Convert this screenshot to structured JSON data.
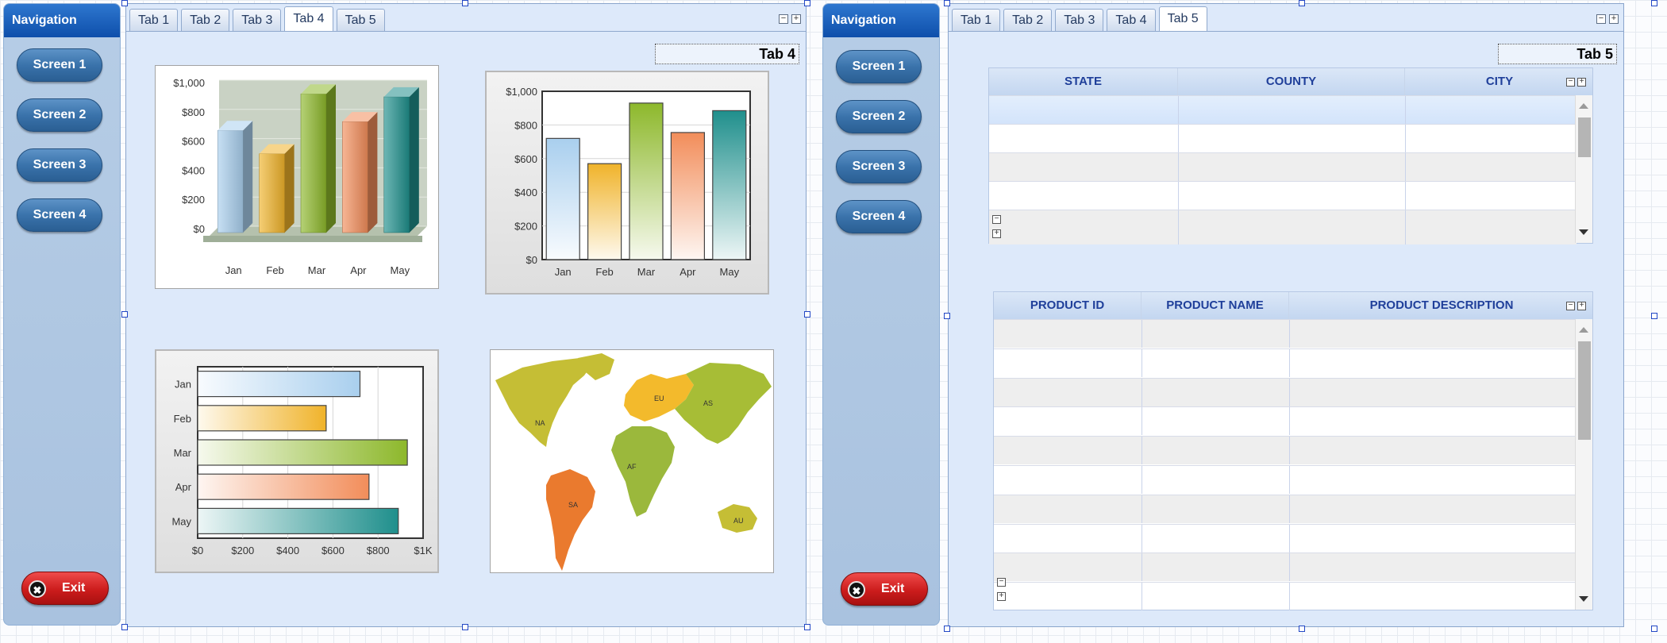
{
  "left": {
    "nav": {
      "title": "Navigation",
      "buttons": [
        "Screen 1",
        "Screen 2",
        "Screen 3",
        "Screen 4"
      ],
      "exit": "Exit"
    },
    "tabs": [
      "Tab 1",
      "Tab 2",
      "Tab 3",
      "Tab 4",
      "Tab 5"
    ],
    "active_tab": "Tab 4",
    "tab_indicator": "Tab 4",
    "map_labels": [
      "NA",
      "EU",
      "AS",
      "AF",
      "SA",
      "AU"
    ]
  },
  "right": {
    "nav": {
      "title": "Navigation",
      "buttons": [
        "Screen 1",
        "Screen 2",
        "Screen 3",
        "Screen 4"
      ],
      "exit": "Exit"
    },
    "tabs": [
      "Tab 1",
      "Tab 2",
      "Tab 3",
      "Tab 4",
      "Tab 5"
    ],
    "active_tab": "Tab 5",
    "tab_indicator": "Tab 5",
    "grid1": {
      "columns": [
        "STATE",
        "COUNTY",
        "CITY"
      ],
      "row_count": 5
    },
    "grid2": {
      "columns": [
        "PRODUCT ID",
        "PRODUCT NAME",
        "PRODUCT DESCRIPTION"
      ],
      "row_count": 10
    }
  },
  "colors": {
    "jan": "#a9cfee",
    "feb": "#f0b32a",
    "mar": "#8db82b",
    "apr": "#f28d5a",
    "may": "#1f8f8c",
    "nav_header": "#0e4fab",
    "exit": "#cc1c1c"
  },
  "chart_data": [
    {
      "type": "bar",
      "style": "3d-column",
      "categories": [
        "Jan",
        "Feb",
        "Mar",
        "Apr",
        "May"
      ],
      "values": [
        700,
        540,
        950,
        760,
        930
      ],
      "yticks": [
        "$0",
        "$200",
        "$400",
        "$600",
        "$800",
        "$1,000"
      ],
      "ylim": [
        0,
        1000
      ],
      "grid": true
    },
    {
      "type": "bar",
      "style": "column",
      "categories": [
        "Jan",
        "Feb",
        "Mar",
        "Apr",
        "May"
      ],
      "values": [
        720,
        570,
        930,
        755,
        885
      ],
      "yticks": [
        "$0",
        "$200",
        "$400",
        "$600",
        "$800",
        "$1,000"
      ],
      "ylim": [
        0,
        1000
      ],
      "grid": true
    },
    {
      "type": "bar",
      "style": "horizontal",
      "categories": [
        "Jan",
        "Feb",
        "Mar",
        "Apr",
        "May"
      ],
      "values": [
        720,
        570,
        930,
        760,
        890
      ],
      "xticks": [
        "$0",
        "$200",
        "$400",
        "$600",
        "$800",
        "$1K"
      ],
      "xlim": [
        0,
        1000
      ],
      "grid": true
    }
  ]
}
